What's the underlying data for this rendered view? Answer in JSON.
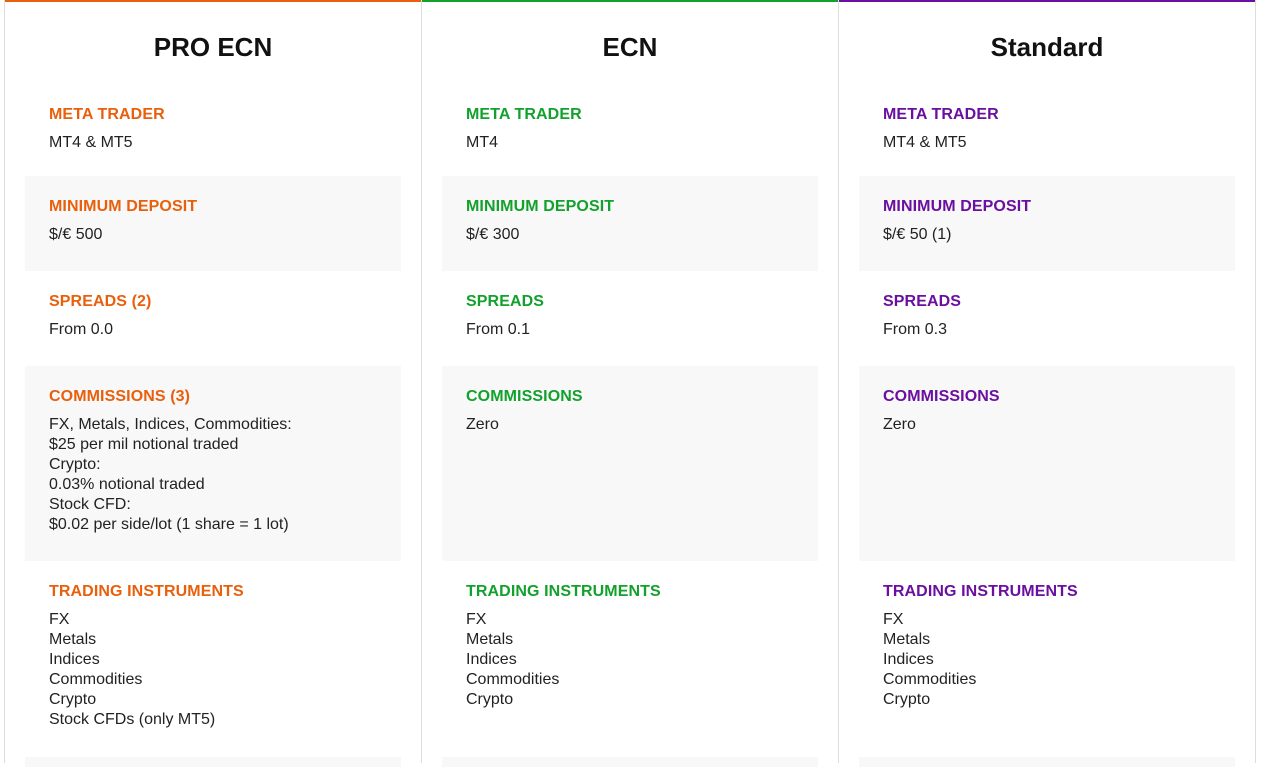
{
  "plans": [
    {
      "title": "PRO ECN",
      "accent": "#e8600c",
      "meta_trader": {
        "label": "META TRADER",
        "value": "MT4 & MT5"
      },
      "minimum_deposit": {
        "label": "MINIMUM DEPOSIT",
        "value": "$/€ 500"
      },
      "spreads": {
        "label": "SPREADS (2)",
        "value": "From 0.0"
      },
      "commissions": {
        "label": "COMMISSIONS (3)",
        "lines": [
          "FX, Metals, Indices, Commodities:",
          "$25 per mil notional traded",
          "Crypto:",
          "0.03% notional traded",
          "Stock CFD:",
          "$0.02 per side/lot (1 share = 1 lot)"
        ]
      },
      "trading_instruments": {
        "label": "TRADING INSTRUMENTS",
        "items": [
          "FX",
          "Metals",
          "Indices",
          "Commodities",
          "Crypto",
          "Stock CFDs (only MT5)"
        ]
      }
    },
    {
      "title": "ECN",
      "accent": "#12a12c",
      "meta_trader": {
        "label": "META TRADER",
        "value": "MT4"
      },
      "minimum_deposit": {
        "label": "MINIMUM DEPOSIT",
        "value": "$/€ 300"
      },
      "spreads": {
        "label": "SPREADS",
        "value": "From 0.1"
      },
      "commissions": {
        "label": "COMMISSIONS",
        "lines": [
          "Zero"
        ]
      },
      "trading_instruments": {
        "label": "TRADING INSTRUMENTS",
        "items": [
          "FX",
          "Metals",
          "Indices",
          "Commodities",
          "Crypto"
        ]
      }
    },
    {
      "title": "Standard",
      "accent": "#6a0fa0",
      "meta_trader": {
        "label": "META TRADER",
        "value": "MT4 & MT5"
      },
      "minimum_deposit": {
        "label": "MINIMUM DEPOSIT",
        "value": "$/€ 50 (1)"
      },
      "spreads": {
        "label": "SPREADS",
        "value": "From 0.3"
      },
      "commissions": {
        "label": "COMMISSIONS",
        "lines": [
          "Zero"
        ]
      },
      "trading_instruments": {
        "label": "TRADING INSTRUMENTS",
        "items": [
          "FX",
          "Metals",
          "Indices",
          "Commodities",
          "Crypto"
        ]
      }
    }
  ]
}
